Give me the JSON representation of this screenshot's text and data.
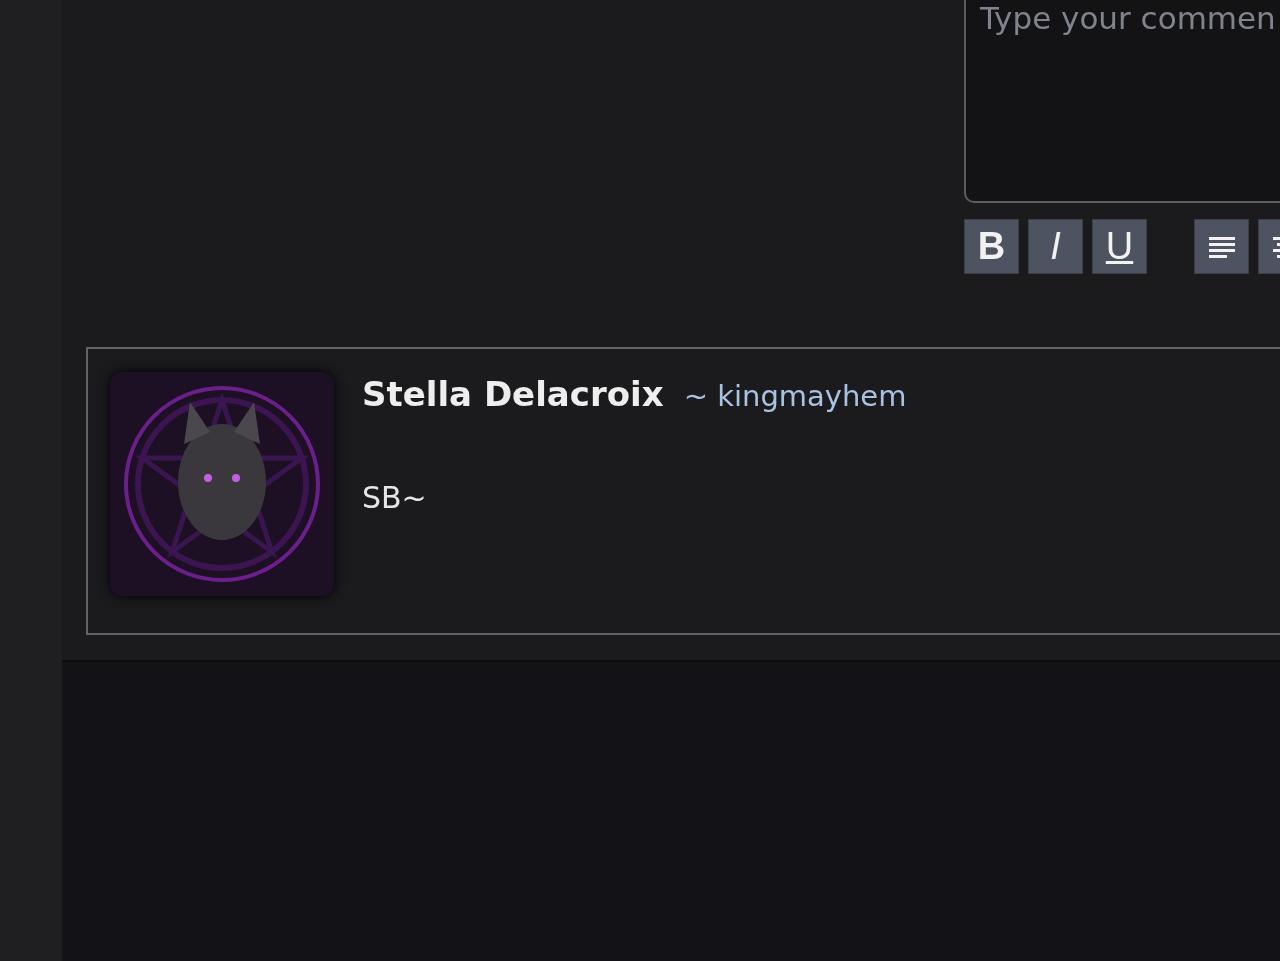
{
  "comment_form": {
    "placeholder": "Type your commen",
    "toolbar": [
      {
        "kind": "bold",
        "label": "B"
      },
      {
        "kind": "italic",
        "label": "I"
      },
      {
        "kind": "underline",
        "label": "U"
      },
      {
        "kind": "align-left"
      },
      {
        "kind": "align-center"
      }
    ]
  },
  "comments": [
    {
      "name": "Stella Delacroix",
      "username": "~ kingmayhem",
      "body": "SB~"
    }
  ]
}
